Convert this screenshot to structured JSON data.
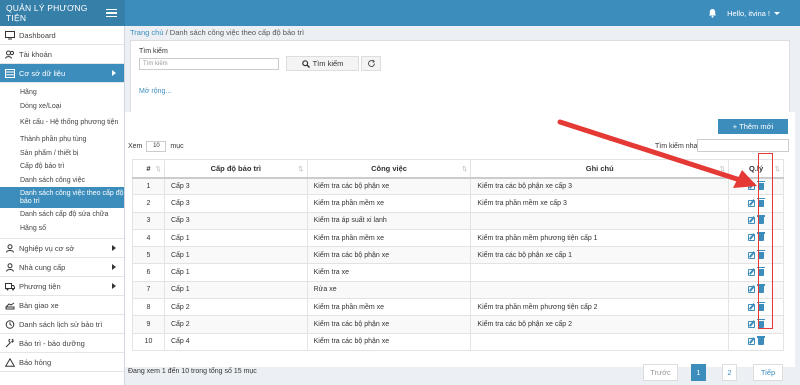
{
  "app": {
    "title": "QUẢN LÝ PHƯƠNG TIỆN",
    "user_greeting": "Hello, itvina !"
  },
  "sidebar": {
    "items": [
      {
        "label": "Dashboard",
        "icon": "monitor-icon"
      },
      {
        "label": "Tài khoản",
        "icon": "users-icon"
      },
      {
        "label": "Cơ sở dữ liệu",
        "icon": "database-icon",
        "active": true
      }
    ],
    "subitems": [
      "Hãng",
      "Dòng xe/Loại",
      "Kết cấu - Hệ thống phương tiện",
      "Thành phần phụ tùng",
      "Sản phẩm / thiết bị",
      "Cấp độ bảo trì",
      "Danh sách công việc",
      "Danh sách công việc theo cấp độ bảo trì",
      "Danh sách cấp độ sửa chữa",
      "Hãng số"
    ],
    "items_after": [
      {
        "label": "Nghiệp vụ cơ sở",
        "icon": "user-icon"
      },
      {
        "label": "Nhà cung cấp",
        "icon": "user-icon"
      },
      {
        "label": "Phương tiện",
        "icon": "truck-icon"
      },
      {
        "label": "Bàn giao xe",
        "icon": "handover-icon"
      },
      {
        "label": "Danh sách lịch sử bảo trì",
        "icon": "history-icon"
      },
      {
        "label": "Bảo trì - bảo dưỡng",
        "icon": "wrench-icon"
      },
      {
        "label": "Báo hỏng",
        "icon": "alert-icon"
      }
    ]
  },
  "breadcrumb": {
    "home": "Trang chủ",
    "sep": "/",
    "current": "Danh sách công việc theo cấp độ bảo trì"
  },
  "search": {
    "label": "Tìm kiếm",
    "placeholder": "Tìm kiếm",
    "button": "Tìm kiếm",
    "more": "Mở rộng..."
  },
  "toolbar": {
    "add_label": "+ Thêm mới",
    "length_prefix": "Xem",
    "length_value": "10",
    "length_suffix": "mục",
    "quick_search": "Tìm kiếm nhanh"
  },
  "table": {
    "headers": [
      "#",
      "Cấp độ bảo trì",
      "Công việc",
      "Ghi chú",
      "Q.lý"
    ],
    "rows": [
      [
        "1",
        "Cấp 3",
        "Kiểm tra các bộ phận xe",
        "Kiểm tra các bộ phận xe cấp 3"
      ],
      [
        "2",
        "Cấp 3",
        "Kiểm tra phần mềm xe",
        "Kiểm tra phần mềm xe cấp 3"
      ],
      [
        "3",
        "Cấp 3",
        "Kiểm tra áp suất xi lanh",
        ""
      ],
      [
        "4",
        "Cấp 1",
        "Kiểm tra phần mềm xe",
        "Kiểm tra phần mềm phương tiện cấp 1"
      ],
      [
        "5",
        "Cấp 1",
        "Kiểm tra các bộ phận xe",
        "Kiểm tra các bộ phận xe cấp 1"
      ],
      [
        "6",
        "Cấp 1",
        "Kiểm tra xe",
        ""
      ],
      [
        "7",
        "Cấp 1",
        "Rửa xe",
        ""
      ],
      [
        "8",
        "Cấp 2",
        "Kiểm tra phần mềm xe",
        "Kiểm tra phần mềm phương tiện cấp 2"
      ],
      [
        "9",
        "Cấp 2",
        "Kiểm tra các bộ phận xe",
        "Kiểm tra các bộ phận xe cấp 2"
      ],
      [
        "10",
        "Cấp 4",
        "Kiểm tra các bộ phận xe",
        ""
      ]
    ]
  },
  "footer": {
    "info": "Đang xem 1 đến 10 trong tổng số 15 mục",
    "prev": "Trước",
    "page1": "1",
    "page2": "2",
    "next": "Tiếp"
  },
  "colors": {
    "primary": "#3c8dbc",
    "annotation": "#e53935"
  }
}
